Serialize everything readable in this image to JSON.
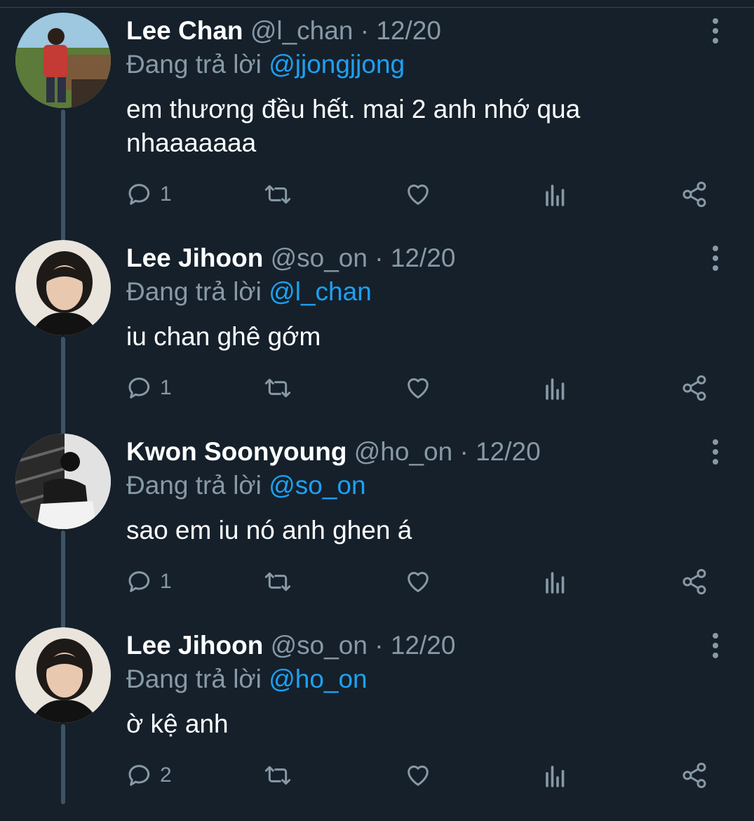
{
  "tweets": [
    {
      "name": "Lee Chan",
      "handle": "@l_chan",
      "date": "12/20",
      "reply_prefix": "Đang trả lời",
      "reply_to": "@jjongjjong",
      "text": "em thương đều hết. mai 2 anh nhớ qua nhaaaaaaa",
      "reply_count": "1",
      "avatar": "outdoor-photo"
    },
    {
      "name": "Lee Jihoon",
      "handle": "@so_on",
      "date": "12/20",
      "reply_prefix": "Đang trả lời",
      "reply_to": "@l_chan",
      "text": "iu chan ghê gớm",
      "reply_count": "1",
      "avatar": "portrait-photo"
    },
    {
      "name": "Kwon Soonyoung",
      "handle": "@ho_on",
      "date": "12/20",
      "reply_prefix": "Đang trả lời",
      "reply_to": "@so_on",
      "text": "sao em iu nó anh ghen á",
      "reply_count": "1",
      "avatar": "bw-stairs-photo"
    },
    {
      "name": "Lee Jihoon",
      "handle": "@so_on",
      "date": "12/20",
      "reply_prefix": "Đang trả lời",
      "reply_to": "@ho_on",
      "text": "ờ kệ anh",
      "reply_count": "2",
      "avatar": "portrait-photo"
    }
  ],
  "separator": "·",
  "icons": [
    "reply-icon",
    "retweet-icon",
    "like-icon",
    "analytics-icon",
    "share-icon",
    "more-icon"
  ],
  "colors": {
    "background": "#15202b",
    "muted": "#8899a6",
    "accent": "#1da1f2",
    "thread_line": "#3d5466"
  }
}
